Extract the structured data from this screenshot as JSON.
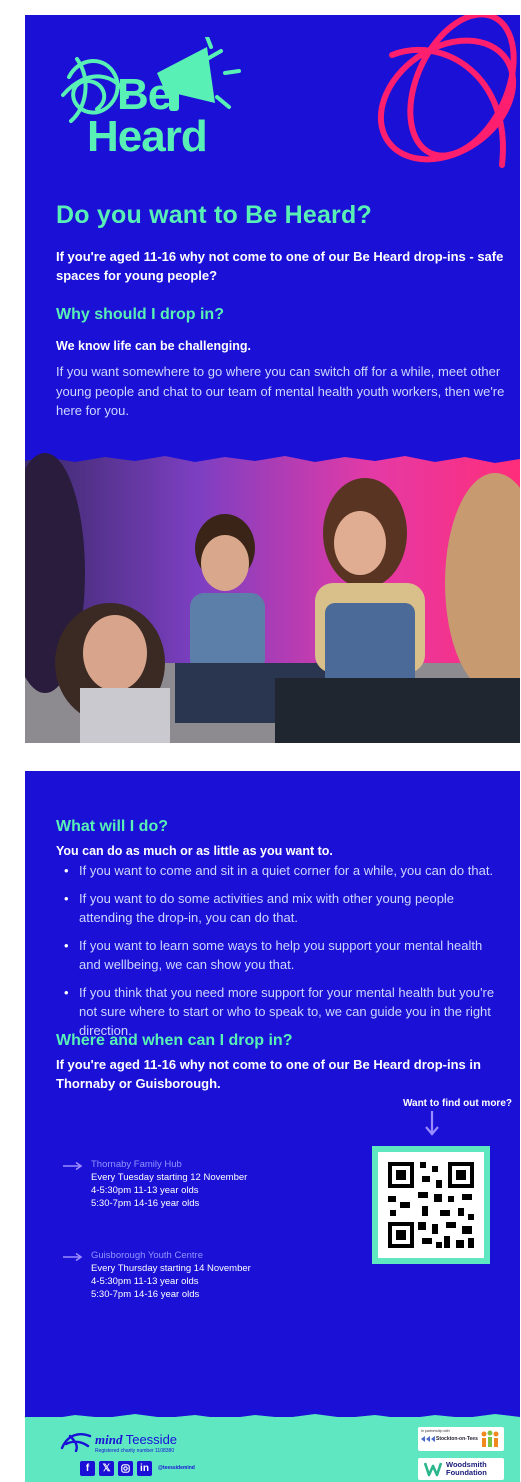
{
  "logo": {
    "line1": "Be",
    "line2": "Heard"
  },
  "heading": "Do you want to Be Heard?",
  "intro": "If you're aged 11-16 why not come to one of our Be Heard drop-ins - safe spaces for young people?",
  "why": {
    "heading": "Why should I drop in?",
    "lead": "We know life can be challenging.",
    "body": "If you want somewhere to go where you can switch off for a while, meet other young people and chat to our team of mental health youth workers, then we're here for you."
  },
  "what": {
    "heading": "What will I do?",
    "lead": "You can do as much or as little as you want to.",
    "bullets": [
      "If you want to come and sit in a quiet corner for a while, you can do that.",
      "If you want to do some activities and mix with other young people attending the drop-in, you can do that.",
      "If you want to learn some ways to help you support your mental health and wellbeing, we can show you that.",
      "If you think that you need more support for your mental health but you're not sure where to start or who to speak to, we can guide you in the right direction."
    ]
  },
  "where": {
    "heading": "Where and when can I drop in?",
    "lead": "If you're aged 11-16 why not come to one of our Be Heard drop-ins in Thornaby or Guisborough.",
    "find_more": "Want to find out more?",
    "locations": [
      {
        "name": "Thornaby Family Hub",
        "lines": [
          "Every Tuesday starting 12 November",
          "4-5:30pm 11-13 year olds",
          "5:30-7pm 14-16 year olds"
        ]
      },
      {
        "name": "Guisborough Youth Centre",
        "lines": [
          "Every Thursday starting 14 November",
          "4-5:30pm 11-13 year olds",
          "5:30-7pm 14-16 year olds"
        ]
      }
    ]
  },
  "footer": {
    "org": "Teesside",
    "charity": "Registered charity number 1108380",
    "social_handle": "@teessidemind",
    "social_icons": [
      "facebook-icon",
      "x-icon",
      "instagram-icon",
      "linkedin-icon"
    ],
    "partnership": "In partnership with",
    "council": "Stockton-on-Tees",
    "funder_line1": "Woodsmith",
    "funder_line2": "Foundation"
  },
  "colors": {
    "brand_blue": "#1a10d6",
    "mint": "#59f0b6",
    "pink": "#ff1f6e",
    "lavender": "#8f95ff"
  }
}
